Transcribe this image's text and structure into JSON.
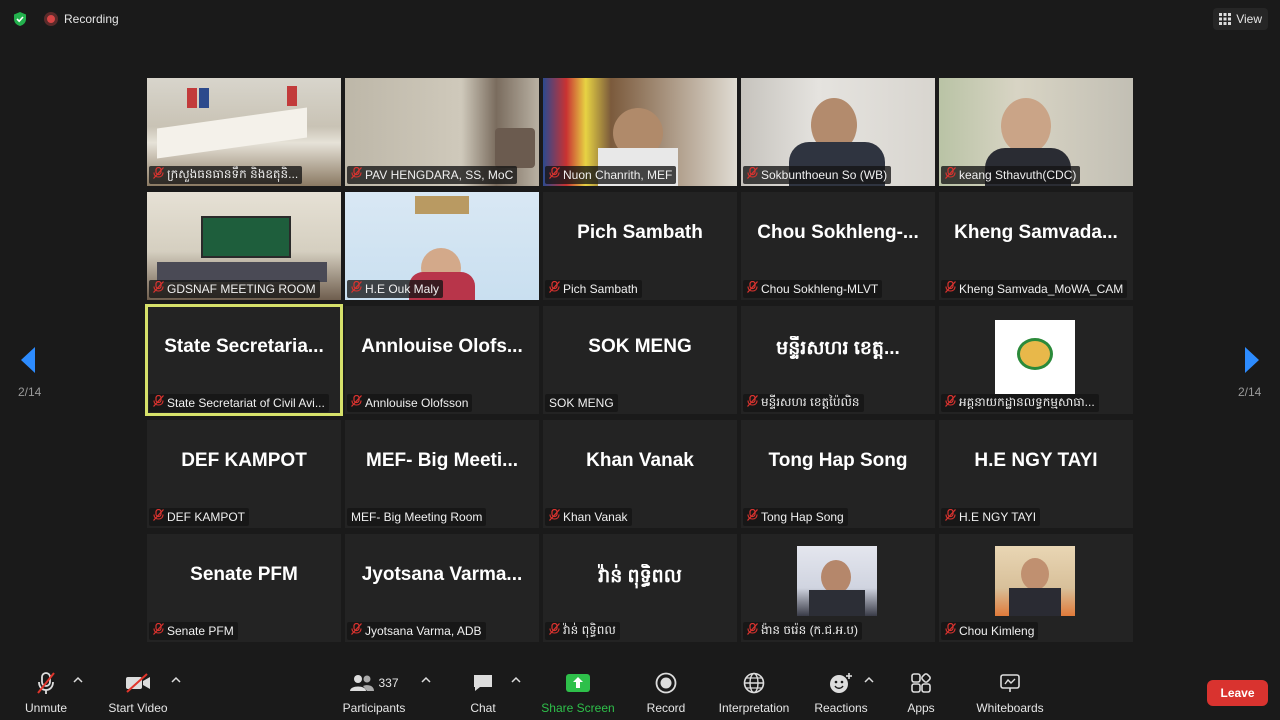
{
  "topbar": {
    "recording_label": "Recording",
    "view_label": "View"
  },
  "nav": {
    "page_left": "2/14",
    "page_right": "2/14"
  },
  "tiles": [
    {
      "label": "ក្រសួងធនធានទឹក និងឧតុនិ...",
      "big": "",
      "video": "room"
    },
    {
      "label": "PAV HENGDARA, SS, MoC",
      "big": "",
      "video": "wall"
    },
    {
      "label": "Nuon Chanrith, MEF",
      "big": "",
      "video": "flags"
    },
    {
      "label": "Sokbunthoeun So (WB)",
      "big": "",
      "video": "person"
    },
    {
      "label": "keang Sthavuth(CDC)",
      "big": "",
      "video": "elder"
    },
    {
      "label": "GDSNAF MEETING ROOM",
      "big": "",
      "video": "meeting"
    },
    {
      "label": "H.E Ouk Maly",
      "big": "",
      "video": "bank"
    },
    {
      "label": "Pich Sambath",
      "big": "Pich Sambath",
      "video": ""
    },
    {
      "label": "Chou Sokhleng-MLVT",
      "big": "Chou Sokhleng-...",
      "video": ""
    },
    {
      "label": "Kheng Samvada_MoWA_CAM",
      "big": "Kheng Samvada...",
      "video": ""
    },
    {
      "label": "State Secretariat of Civil Avi...",
      "big": "State Secretaria...",
      "video": "",
      "active": true
    },
    {
      "label": "Annlouise Olofsson",
      "big": "Annlouise Olofs...",
      "video": ""
    },
    {
      "label": "SOK MENG",
      "big": "SOK MENG",
      "video": "",
      "no_mic": true
    },
    {
      "label": "មន្ទីរសហរ ខេត្តប៉ៃលិន",
      "big": "មន្ទីរសហរ ខេត្ត...",
      "video": ""
    },
    {
      "label": "អគ្គនាយកដ្ឋានលទ្ធកម្មសាធា...",
      "big": "",
      "video": "logo"
    },
    {
      "label": "DEF KAMPOT",
      "big": "DEF KAMPOT",
      "video": ""
    },
    {
      "label": "MEF- Big Meeting Room",
      "big": "MEF- Big Meeti...",
      "video": "",
      "no_mic": true
    },
    {
      "label": "Khan Vanak",
      "big": "Khan Vanak",
      "video": ""
    },
    {
      "label": "Tong Hap Song",
      "big": "Tong Hap Song",
      "video": ""
    },
    {
      "label": "H.E NGY TAYI",
      "big": "H.E NGY TAYI",
      "video": ""
    },
    {
      "label": "Senate PFM",
      "big": "Senate PFM",
      "video": ""
    },
    {
      "label": "Jyotsana Varma, ADB",
      "big": "Jyotsana Varma...",
      "video": ""
    },
    {
      "label": "វ៉ាន់ ពុទ្ធិពល",
      "big": "វ៉ាន់ ពុទ្ធិពល",
      "video": ""
    },
    {
      "label": "ង៉ាន ចរ៉េន (ក.ជ.អ.ប)",
      "big": "",
      "video": "photo1"
    },
    {
      "label": "Chou Kimleng",
      "big": "",
      "video": "photo2"
    }
  ],
  "toolbar": {
    "unmute": "Unmute",
    "start_video": "Start Video",
    "participants": "Participants",
    "participants_count": "337",
    "chat": "Chat",
    "share_screen": "Share Screen",
    "record": "Record",
    "interpretation": "Interpretation",
    "reactions": "Reactions",
    "apps": "Apps",
    "whiteboards": "Whiteboards",
    "leave": "Leave"
  },
  "colors": {
    "accent_green": "#2ec04a",
    "leave_red": "#d9332f",
    "active_outline": "#d6e16a",
    "nav_blue": "#2d8cff"
  }
}
